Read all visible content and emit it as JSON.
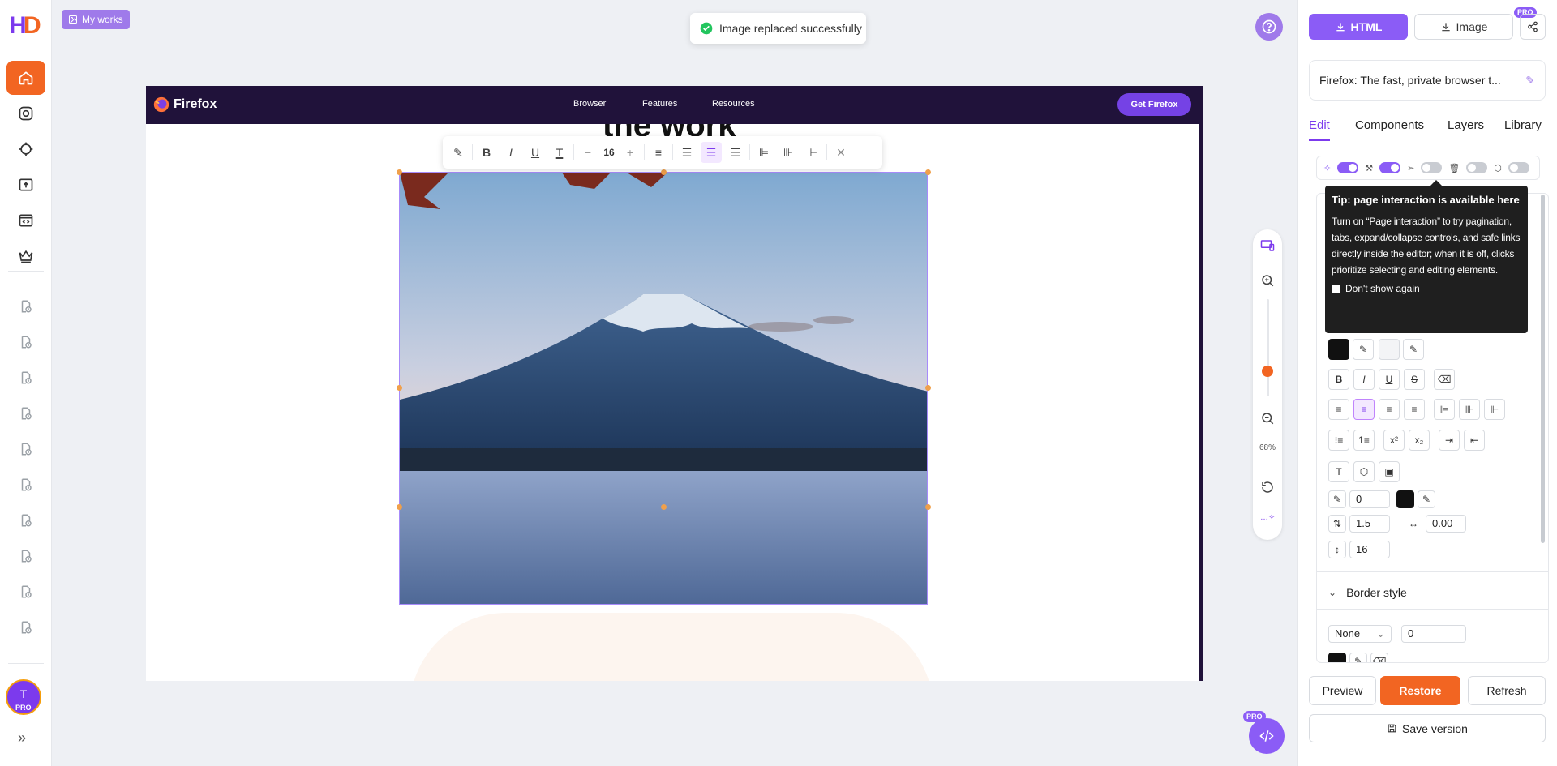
{
  "app": {
    "logo": "HD",
    "my_works": "My works"
  },
  "left_rail": {
    "items": [
      {
        "name": "home",
        "active": true
      },
      {
        "name": "camera"
      },
      {
        "name": "target"
      },
      {
        "name": "upload"
      },
      {
        "name": "code-window"
      },
      {
        "name": "crown"
      }
    ],
    "history_count": 10,
    "avatar_letter": "T",
    "avatar_badge": "PRO"
  },
  "toast": {
    "text": "Image replaced successfully"
  },
  "canvas": {
    "nav": {
      "brand": "Firefox",
      "links": [
        "Browser",
        "Features",
        "Resources"
      ],
      "cta": "Get Firefox"
    },
    "heading_partial": "the work",
    "text_toolbar": {
      "font_size": "16"
    }
  },
  "zoom": {
    "level": "68%"
  },
  "right_panel": {
    "export_html": "HTML",
    "export_image": "Image",
    "pro_badge": "PRO",
    "page_title": "Firefox: The fast, private browser t...",
    "tabs": [
      "Edit",
      "Components",
      "Layers",
      "Library"
    ],
    "active_tab": "Edit",
    "tooltip": {
      "title": "Tip: page interaction is available here",
      "body": "Turn on “Page interaction” to try pagination, tabs, expand/collapse controls, and safe links directly inside the editor; when it is off, clicks prioritize selecting and editing elements.",
      "checkbox_label": "Don't show again"
    },
    "text_style": {
      "stroke_width": "0",
      "line_height": "1.5",
      "letter_spacing": "0.00",
      "font_size": "16"
    },
    "border_style": {
      "label": "Border style",
      "type": "None",
      "width": "0"
    },
    "footer": {
      "preview": "Preview",
      "restore": "Restore",
      "refresh": "Refresh",
      "save_version": "Save version"
    }
  },
  "colors": {
    "accent_purple": "#8b5cf6",
    "accent_orange": "#f26522",
    "nav_bg": "#20123a",
    "success": "#22c55e"
  }
}
